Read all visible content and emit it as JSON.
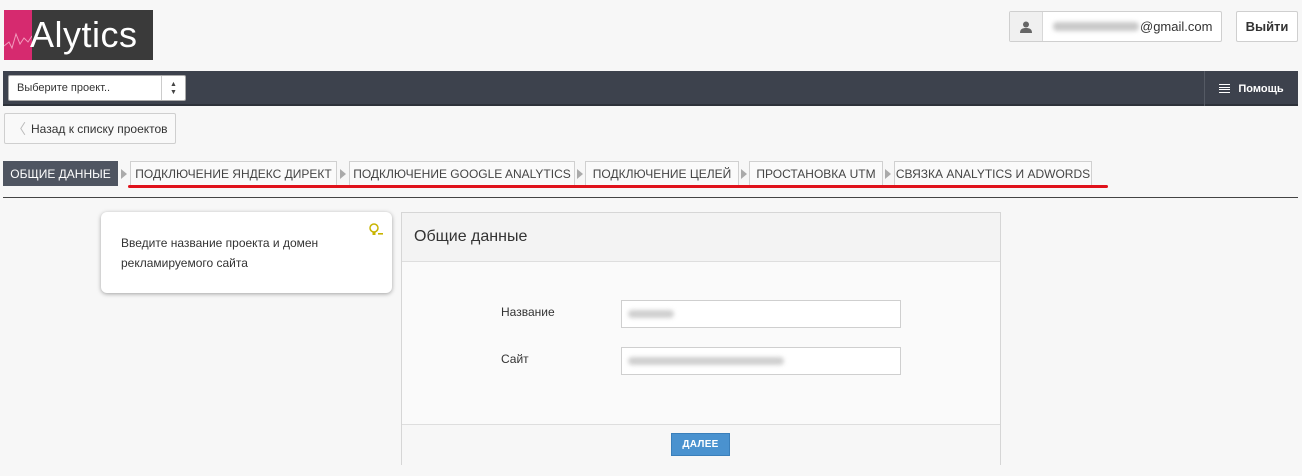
{
  "header": {
    "logo_text": "Alytics",
    "user_email_domain": "@gmail.com",
    "logout_label": "Выйти"
  },
  "topbar": {
    "project_select": {
      "placeholder": "Выберите проект.."
    },
    "help_label": "Помощь"
  },
  "back_link_label": "Назад к списку проектов",
  "steps": [
    {
      "label": "ОБЩИЕ ДАННЫЕ",
      "active": true
    },
    {
      "label": "ПОДКЛЮЧЕНИЕ ЯНДЕКС ДИРЕКТ",
      "active": false
    },
    {
      "label": "ПОДКЛЮЧЕНИЕ GOOGLE ANALYTICS",
      "active": false
    },
    {
      "label": "ПОДКЛЮЧЕНИЕ ЦЕЛЕЙ",
      "active": false
    },
    {
      "label": "ПРОСТАНОВКА UTM",
      "active": false
    },
    {
      "label": "СВЯЗКА ANALYTICS И ADWORDS",
      "active": false
    }
  ],
  "hint": {
    "text": "Введите название проекта и домен рекламируемого сайта"
  },
  "panel": {
    "title": "Общие данные",
    "fields": [
      {
        "label": "Название"
      },
      {
        "label": "Сайт"
      }
    ],
    "next_label": "ДАЛЕЕ"
  },
  "colors": {
    "accent": "#d62a6f",
    "topbar": "#3d424d",
    "active_step": "#4f5561",
    "underline": "#e0121b",
    "primary_button": "#4a92cf"
  }
}
